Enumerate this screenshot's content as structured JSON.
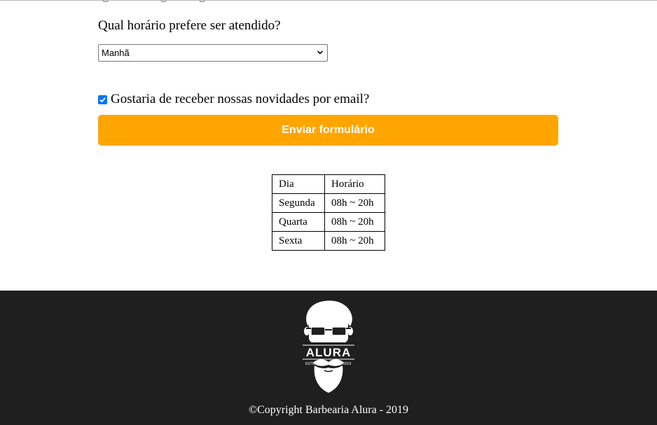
{
  "contact_form": {
    "question_label": "Qual horário prefere ser atendido?",
    "time_select": {
      "selected": "Manhã"
    },
    "newsletter_label": "Gostaria de receber nossas novidades por email?",
    "newsletter_checked": true,
    "submit_label": "Enviar formulário"
  },
  "hours_table": {
    "headers": [
      "Dia",
      "Horário"
    ],
    "rows": [
      [
        "Segunda",
        "08h ~ 20h"
      ],
      [
        "Quarta",
        "08h ~ 20h"
      ],
      [
        "Sexta",
        "08h ~ 20h"
      ]
    ]
  },
  "footer": {
    "logo": {
      "brand": "ALURA",
      "estd": "ESTD",
      "year": "2019"
    },
    "copyright": "©Copyright Barbearia Alura - 2019"
  },
  "colors": {
    "accent": "#ffa500",
    "footer_bg": "#1e1f1e",
    "checkbox": "#0075ff"
  },
  "icons": [
    "radio-icon",
    "chevron-down-icon",
    "checkbox-checked-icon",
    "barber-logo-icon"
  ]
}
